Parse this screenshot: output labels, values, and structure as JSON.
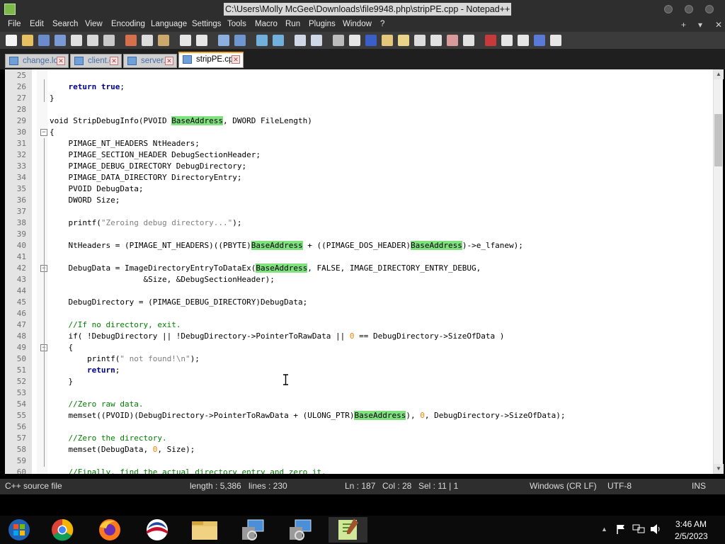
{
  "window": {
    "title": "C:\\Users\\Molly McGee\\Downloads\\file9948.php\\stripPE.cpp - Notepad++"
  },
  "menu": [
    "File",
    "Edit",
    "Search",
    "View",
    "Encoding",
    "Language",
    "Settings",
    "Tools",
    "Macro",
    "Run",
    "Plugins",
    "Window",
    "?"
  ],
  "menu_right": {
    "plus": "+",
    "chevron": "▾",
    "close": "✕"
  },
  "tabs": [
    {
      "label": "change.log",
      "active": false
    },
    {
      "label": "client.c",
      "active": false
    },
    {
      "label": "server.c",
      "active": false
    },
    {
      "label": "stripPE.cpp",
      "active": true
    }
  ],
  "editor": {
    "lines": [
      {
        "n": "25",
        "html": ""
      },
      {
        "n": "26",
        "html": "    <span class=\"kw\">return</span> <span class=\"kw\">true</span>;"
      },
      {
        "n": "27",
        "html": "}"
      },
      {
        "n": "28",
        "html": ""
      },
      {
        "n": "29",
        "html": "void StripDebugInfo(PVOID <span class=\"hl\">BaseAddress</span>, DWORD FileLength)"
      },
      {
        "n": "30",
        "html": "{"
      },
      {
        "n": "31",
        "html": "    PIMAGE_NT_HEADERS NtHeaders;"
      },
      {
        "n": "32",
        "html": "    PIMAGE_SECTION_HEADER DebugSectionHeader;"
      },
      {
        "n": "33",
        "html": "    PIMAGE_DEBUG_DIRECTORY DebugDirectory;"
      },
      {
        "n": "34",
        "html": "    PIMAGE_DATA_DIRECTORY DirectoryEntry;"
      },
      {
        "n": "35",
        "html": "    PVOID DebugData;"
      },
      {
        "n": "36",
        "html": "    DWORD Size;"
      },
      {
        "n": "37",
        "html": ""
      },
      {
        "n": "38",
        "html": "    printf(<span class=\"st\">\"Zeroing debug directory...\"</span>);"
      },
      {
        "n": "39",
        "html": ""
      },
      {
        "n": "40",
        "html": "    NtHeaders = (PIMAGE_NT_HEADERS)((PBYTE)<span class=\"hl\">BaseAddress</span> + ((PIMAGE_DOS_HEADER)<span class=\"hl\">BaseAddress</span>)->e_lfanew);"
      },
      {
        "n": "41",
        "html": ""
      },
      {
        "n": "42",
        "html": "    DebugData = ImageDirectoryEntryToDataEx(<span class=\"hl\">BaseAddress</span>, FALSE, IMAGE_DIRECTORY_ENTRY_DEBUG,"
      },
      {
        "n": "43",
        "html": "                    &amp;Size, &amp;DebugSectionHeader);"
      },
      {
        "n": "44",
        "html": ""
      },
      {
        "n": "45",
        "html": "    DebugDirectory = (PIMAGE_DEBUG_DIRECTORY)DebugData;"
      },
      {
        "n": "46",
        "html": ""
      },
      {
        "n": "47",
        "html": "    <span class=\"cm\">//If no directory, exit.</span>"
      },
      {
        "n": "48",
        "html": "    if( !DebugDirectory || !DebugDirectory->PointerToRawData || <span class=\"nm\">0</span> == DebugDirectory->SizeOfData )"
      },
      {
        "n": "49",
        "html": "    {"
      },
      {
        "n": "50",
        "html": "        printf(<span class=\"st\">\" not found!\\n\"</span>);"
      },
      {
        "n": "51",
        "html": "        <span class=\"kw\">return</span>;"
      },
      {
        "n": "52",
        "html": "    }"
      },
      {
        "n": "53",
        "html": ""
      },
      {
        "n": "54",
        "html": "    <span class=\"cm\">//Zero raw data.</span>"
      },
      {
        "n": "55",
        "html": "    memset((PVOID)(DebugDirectory->PointerToRawData + (ULONG_PTR)<span class=\"hl\">BaseAddress</span>), <span class=\"nm\">0</span>, DebugDirectory->SizeOfData);"
      },
      {
        "n": "56",
        "html": ""
      },
      {
        "n": "57",
        "html": "    <span class=\"cm\">//Zero the directory.</span>"
      },
      {
        "n": "58",
        "html": "    memset(DebugData, <span class=\"nm\">0</span>, Size);"
      },
      {
        "n": "59",
        "html": ""
      },
      {
        "n": "60",
        "html": "    <span class=\"cm\">//Finally, find the actual directory entry and zero it.</span>"
      }
    ],
    "colors": {
      "highlight": "#7fe27f",
      "keyword": "#00008b",
      "comment": "#008000",
      "string": "#808080",
      "number": "#ff8000"
    }
  },
  "status": {
    "filetype": "C++ source file",
    "length": "length : 5,386",
    "lines": "lines : 230",
    "ln": "Ln : 187",
    "col": "Col : 28",
    "sel": "Sel : 11 | 1",
    "eol": "Windows (CR LF)",
    "encoding": "UTF-8",
    "mode": "INS"
  },
  "taskbar": {
    "apps": [
      "start-orb-icon",
      "chrome-icon",
      "firefox-icon",
      "obama-logo-icon",
      "file-explorer-icon",
      "network-admin-icon",
      "network-admin-icon-2",
      "notepadpp-icon"
    ],
    "tray": {
      "chevron": "▲",
      "time": "3:46 AM",
      "date": "2/5/2023"
    }
  }
}
